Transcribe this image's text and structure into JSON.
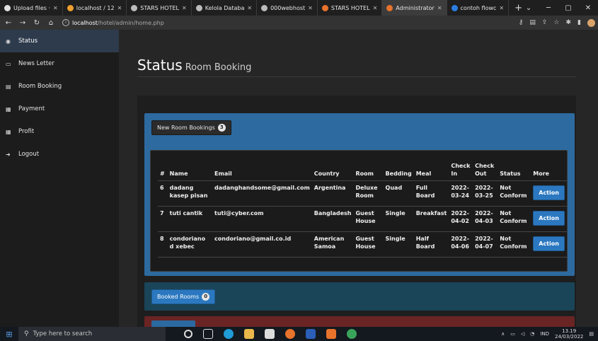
{
  "browser": {
    "tabs": [
      {
        "label": "Upload files ·",
        "color": "#e0e0e0"
      },
      {
        "label": "localhost / 12",
        "color": "#f0a030"
      },
      {
        "label": "STARS HOTEL",
        "color": "#bbbbbb"
      },
      {
        "label": "Kelola Databa",
        "color": "#bbbbbb"
      },
      {
        "label": "000webhost",
        "color": "#bbbbbb"
      },
      {
        "label": "STARS HOTEL",
        "color": "#e8732c"
      },
      {
        "label": "Administrator",
        "color": "#e8732c"
      },
      {
        "label": "contoh flowc",
        "color": "#2a7de1"
      }
    ],
    "active_tab_index": 6,
    "new_tab": "+",
    "url_host": "localhost",
    "url_path": "/hotel/admin/home.php"
  },
  "sidebar": {
    "items": [
      {
        "label": "Status",
        "icon": "dashboard-icon",
        "glyph": "◉",
        "active": true
      },
      {
        "label": "News Letter",
        "icon": "monitor-icon",
        "glyph": "▭",
        "active": false
      },
      {
        "label": "Room Booking",
        "icon": "chart-icon",
        "glyph": "▤",
        "active": false
      },
      {
        "label": "Payment",
        "icon": "list-icon",
        "glyph": "▦",
        "active": false
      },
      {
        "label": "Profit",
        "icon": "table-icon",
        "glyph": "▦",
        "active": false
      },
      {
        "label": "Logout",
        "icon": "logout-icon",
        "glyph": "➜",
        "active": false
      }
    ]
  },
  "page": {
    "title": "Status",
    "subtitle": "Room Booking"
  },
  "new_bookings": {
    "button_label": "New Room Bookings",
    "count": "3",
    "columns": [
      "#",
      "Name",
      "Email",
      "Country",
      "Room",
      "Bedding",
      "Meal",
      "Check In",
      "Check Out",
      "Status",
      "More"
    ],
    "rows": [
      {
        "id": "6",
        "name": "dadang kasep pisan",
        "email": "dadanghandsome@gmail.com",
        "country": "Argentina",
        "room": "Deluxe Room",
        "bedding": "Quad",
        "meal": "Full Board",
        "check_in": "2022-03-24",
        "check_out": "2022-03-25",
        "status": "Not Conform",
        "action": "Action"
      },
      {
        "id": "7",
        "name": "tuti cantik",
        "email": "tuti@cyber.com",
        "country": "Bangladesh",
        "room": "Guest House",
        "bedding": "Single",
        "meal": "Breakfast",
        "check_in": "2022-04-02",
        "check_out": "2022-04-03",
        "status": "Not Conform",
        "action": "Action"
      },
      {
        "id": "8",
        "name": "condoriano d xebec",
        "email": "condoriano@gmail.co.id",
        "country": "American Samoa",
        "room": "Guest House",
        "bedding": "Single",
        "meal": "Half Board",
        "check_in": "2022-04-06",
        "check_out": "2022-04-07",
        "status": "Not Conform",
        "action": "Action"
      }
    ]
  },
  "booked_rooms": {
    "button_label": "Booked Rooms",
    "count": "0"
  },
  "taskbar": {
    "search_placeholder": "Type here to search",
    "language": "IND",
    "time": "13.19",
    "date": "24/03/2022"
  },
  "colors": {
    "panel_blue": "#2d6a9f",
    "panel_teal": "#1a4458",
    "panel_red": "#6b2424",
    "action_blue": "#2b78c0"
  }
}
